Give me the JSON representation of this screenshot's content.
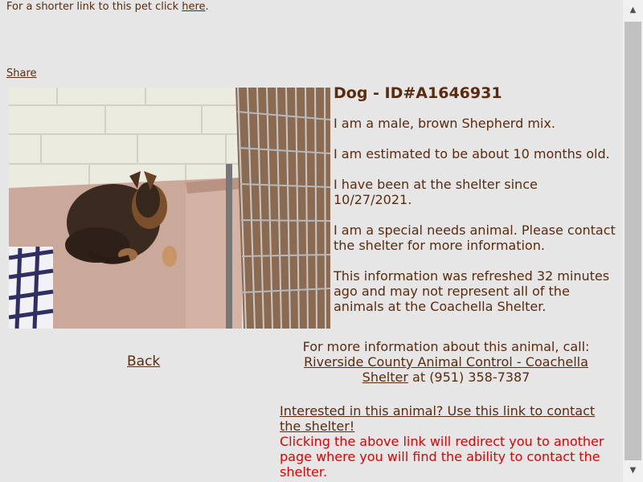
{
  "top_note": {
    "prefix": "For a shorter link to this pet click ",
    "link": "here",
    "suffix": "."
  },
  "share_label": "Share",
  "pet": {
    "title": "Dog - ID#A1646931",
    "lines": [
      "I am a male, brown Shepherd mix.",
      "I am estimated to be about 10 months old.",
      "I have been at the shelter since 10/27/2021.",
      "I am a special needs animal. Please contact the shelter for more information.",
      "This information was refreshed 32 minutes ago and may not represent all of the animals at the Coachella Shelter."
    ]
  },
  "back_label": "Back",
  "contact": {
    "intro": "For more information about this animal, call:",
    "shelter_link": "Riverside County Animal Control - Coachella Shelter",
    "phone_text": " at (951) 358-7387"
  },
  "interest": {
    "link": "Interested in this animal? Use this link to contact the shelter!",
    "warning": "Clicking the above link will redirect you to another page where you will find the ability to contact the shelter."
  },
  "colors": {
    "background": "#e6e6e6",
    "text": "#5a2b0e",
    "warning": "#e00000"
  },
  "icons": {
    "scroll_up": "triangle-up-icon",
    "scroll_down": "triangle-down-icon"
  }
}
